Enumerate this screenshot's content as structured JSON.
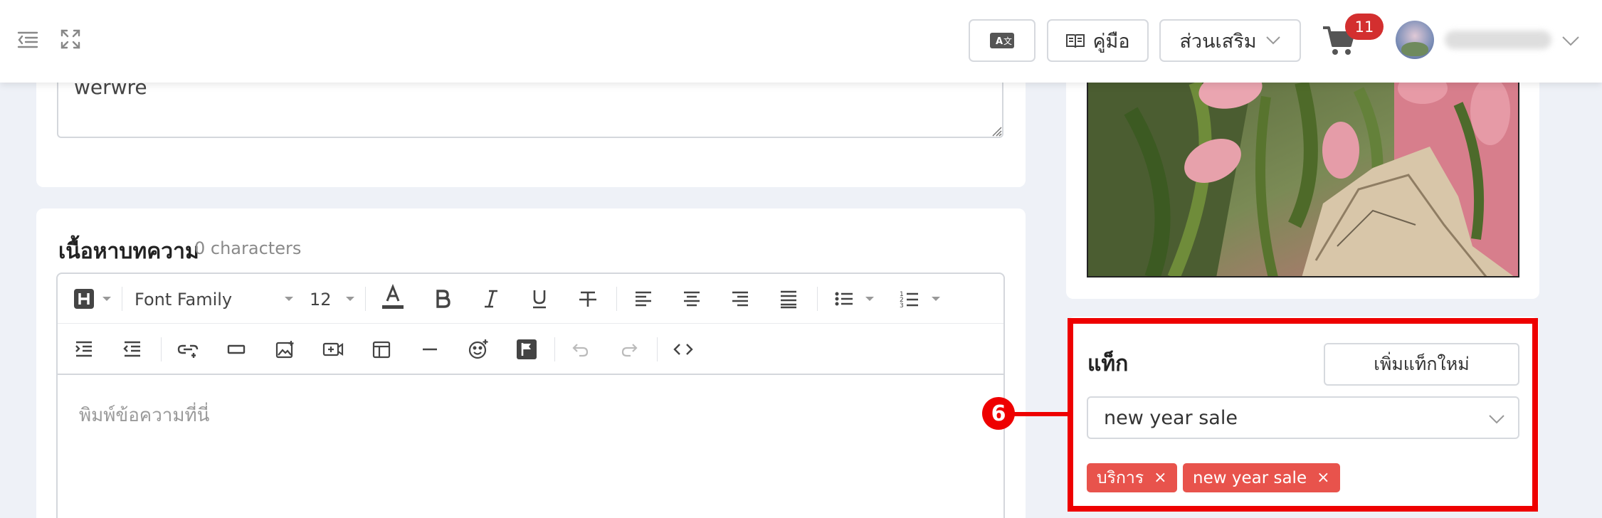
{
  "topbar": {
    "guide_label": "คู่มือ",
    "addons_label": "ส่วนเสริม",
    "cart_count": "11",
    "icons": [
      "collapse-menu-icon",
      "fullscreen-icon",
      "translate-icon",
      "book-icon",
      "chevron-down-icon",
      "cart-icon"
    ]
  },
  "excerpt": {
    "value": "werwre"
  },
  "content_section": {
    "title": "เนื้อหาบทความ",
    "char_count": "0 characters",
    "font_family": "Font Family",
    "font_size": "12",
    "placeholder": "พิมพ์ข้อความที่นี่"
  },
  "tags": {
    "title": "แท็ก",
    "add_button": "เพิ่มแท็กใหม่",
    "selected_value": "new year sale",
    "chips": [
      {
        "label": "บริการ",
        "remove": "×"
      },
      {
        "label": "new year sale",
        "remove": "×"
      }
    ]
  },
  "callout": {
    "number": "6",
    "color": "#ee0000"
  },
  "colors": {
    "chip": "#e8534c",
    "badge": "#d32f2f",
    "background": "#eef1f7"
  }
}
